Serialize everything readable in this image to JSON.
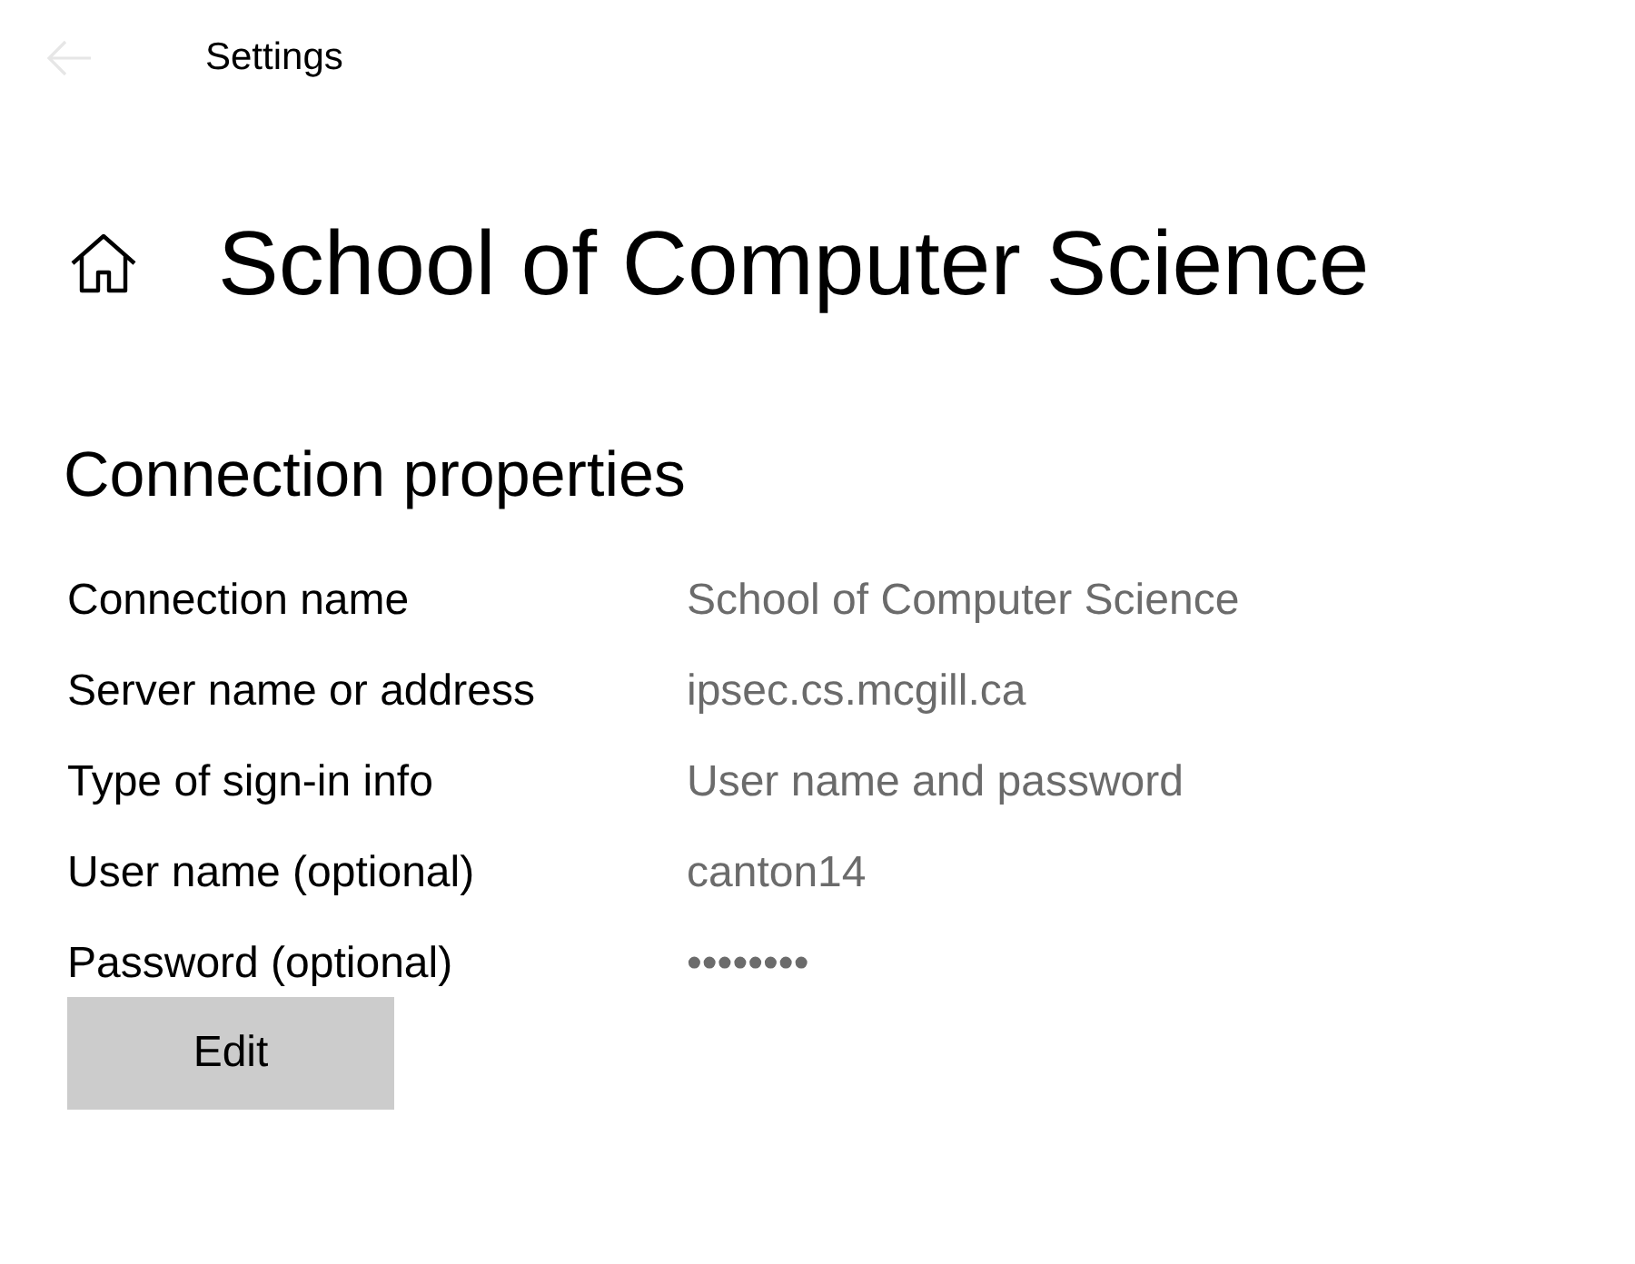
{
  "window": {
    "title": "Settings",
    "back_button": {
      "disabled": true
    }
  },
  "page": {
    "title": "School of Computer Science"
  },
  "section": {
    "title": "Connection properties",
    "properties": [
      {
        "label": "Connection name",
        "value": "School of Computer Science"
      },
      {
        "label": "Server name or address",
        "value": "ipsec.cs.mcgill.ca"
      },
      {
        "label": "Type of sign-in info",
        "value": "User name and password"
      },
      {
        "label": "User name (optional)",
        "value": "canton14"
      },
      {
        "label": "Password (optional)",
        "value": "••••••••"
      }
    ],
    "button": "Edit"
  }
}
